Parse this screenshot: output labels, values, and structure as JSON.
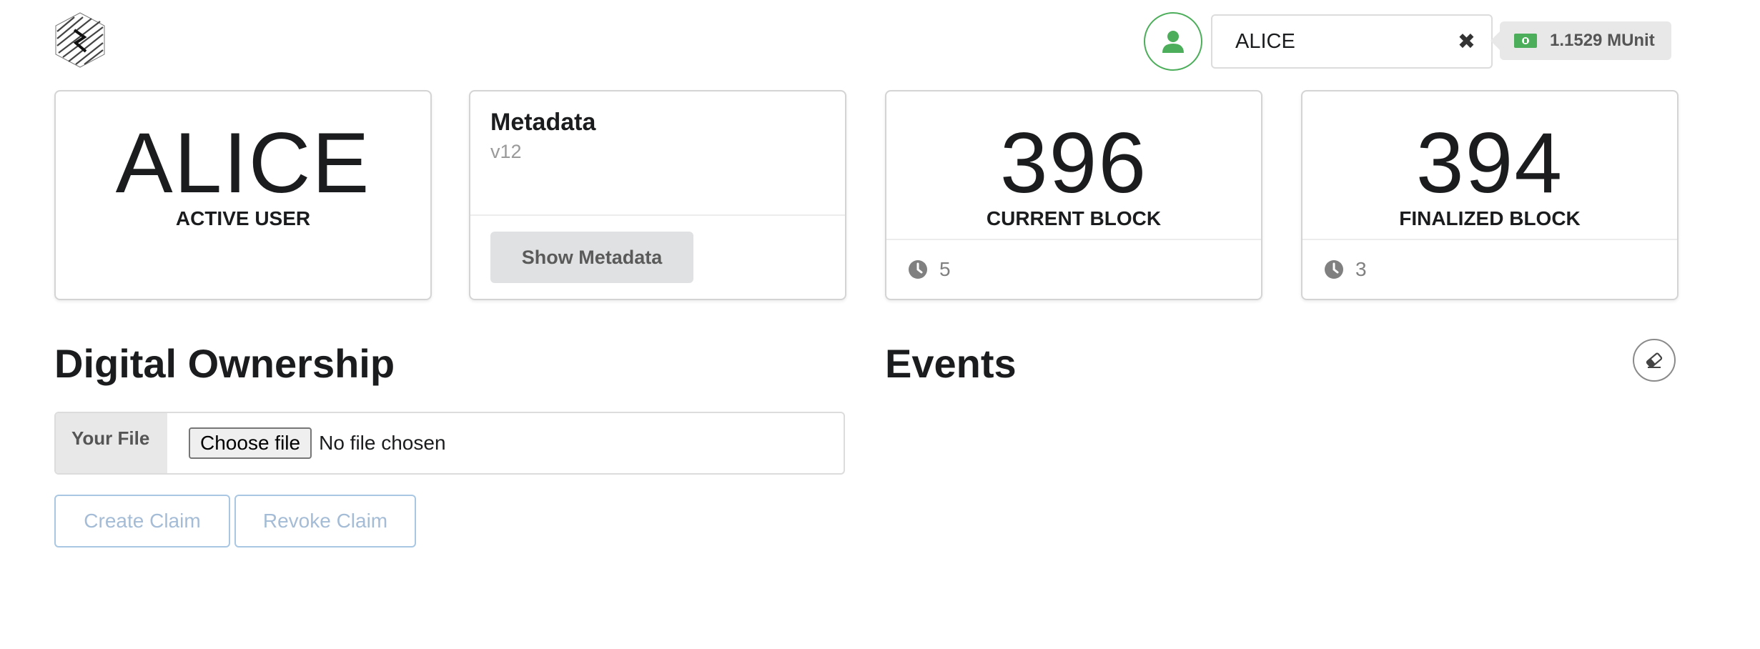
{
  "header": {
    "account": {
      "selected": "ALICE",
      "clear_icon": "close-icon"
    },
    "balance": {
      "value": "1.1529 MUnit",
      "icon": "money-icon"
    }
  },
  "cards": {
    "active_user": {
      "value": "ALICE",
      "label": "ACTIVE USER"
    },
    "metadata": {
      "title": "Metadata",
      "version": "v12",
      "button": "Show Metadata"
    },
    "current_block": {
      "value": "396",
      "label": "CURRENT BLOCK",
      "time": "5"
    },
    "finalized_block": {
      "value": "394",
      "label": "FINALIZED BLOCK",
      "time": "3"
    }
  },
  "ownership": {
    "title": "Digital Ownership",
    "file_label": "Your File",
    "choose_button": "Choose file",
    "no_file_text": "No file chosen",
    "create_button": "Create Claim",
    "revoke_button": "Revoke Claim"
  },
  "events": {
    "title": "Events",
    "clear_icon": "eraser-icon"
  },
  "colors": {
    "accent_green": "#4cae5a",
    "disabled_blue": "#a4bcd6"
  }
}
